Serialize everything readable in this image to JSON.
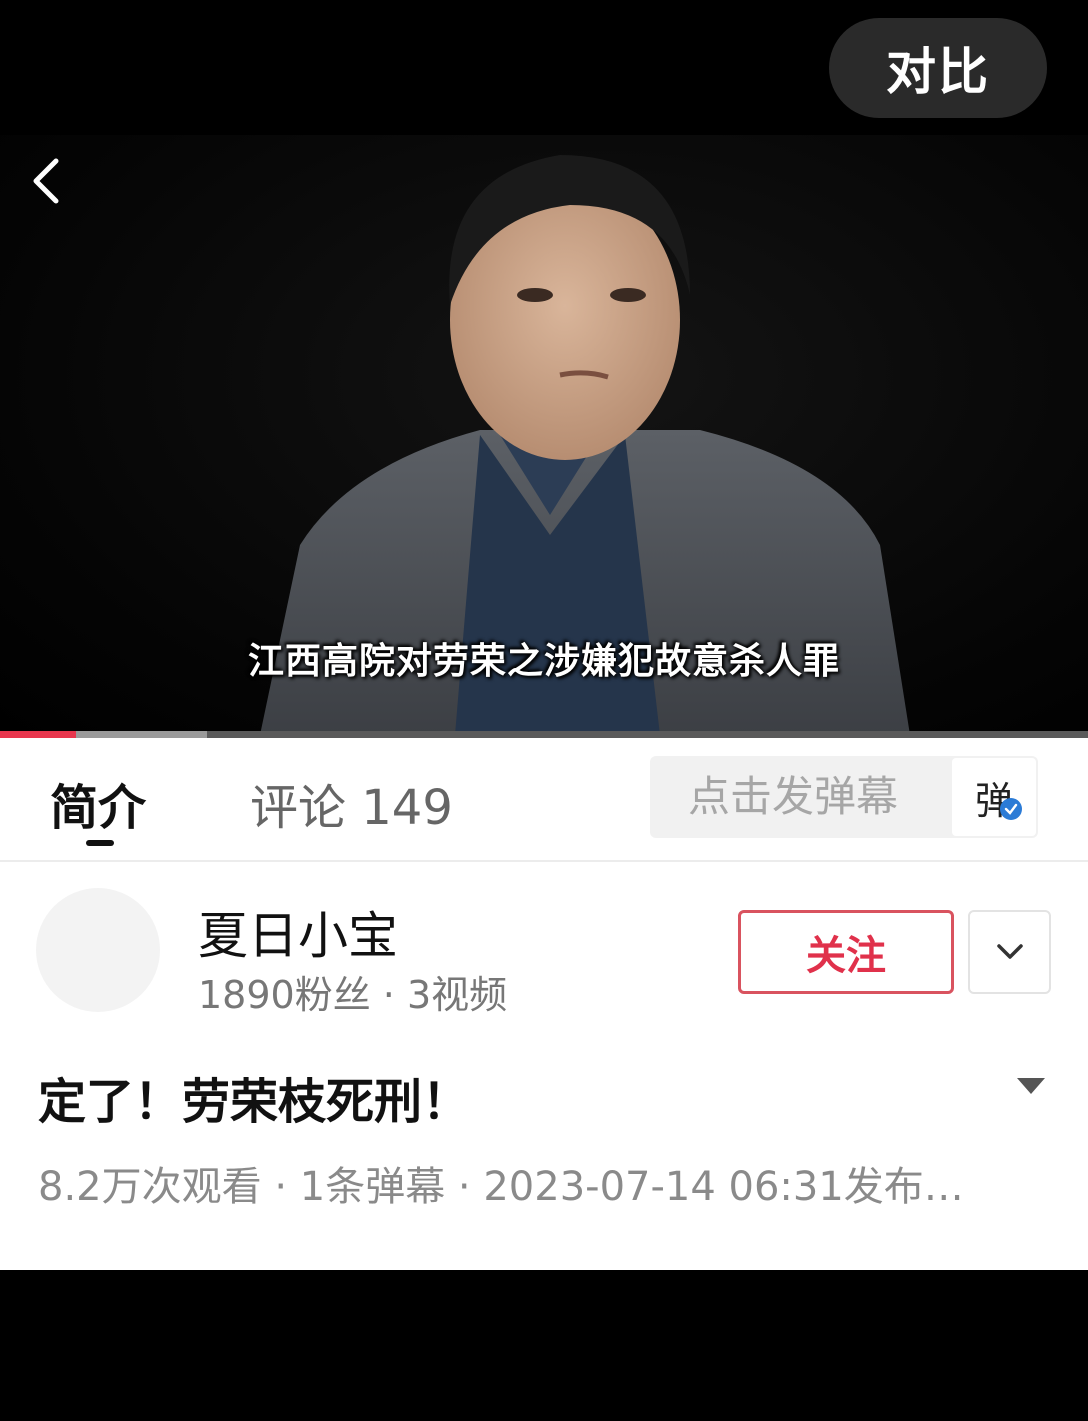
{
  "topbar": {
    "compare_label": "对比"
  },
  "player": {
    "subtitle": "江西高院对劳荣之涉嫌犯故意杀人罪",
    "progress": 0.07,
    "buffered": 0.19
  },
  "tabs": [
    {
      "label": "简介",
      "active": true
    },
    {
      "label": "评论 149",
      "active": false
    }
  ],
  "danmu": {
    "placeholder": "点击发弹幕",
    "toggle_label": "弹"
  },
  "uploader": {
    "name": "夏日小宝",
    "stats": "1890粉丝 · 3视频",
    "follow_label": "关注"
  },
  "video": {
    "title": "定了！劳荣枝死刑！",
    "meta": "8.2万次观看 · 1条弹幕 · 2023-07-14 06:31发布…"
  },
  "colors": {
    "accent": "#e0314b",
    "progress": "#e8364d",
    "badge": "#2b7bd6"
  },
  "icons": [
    "back-arrow-icon",
    "verified-check-icon",
    "chevron-down-icon",
    "expand-triangle-icon"
  ]
}
